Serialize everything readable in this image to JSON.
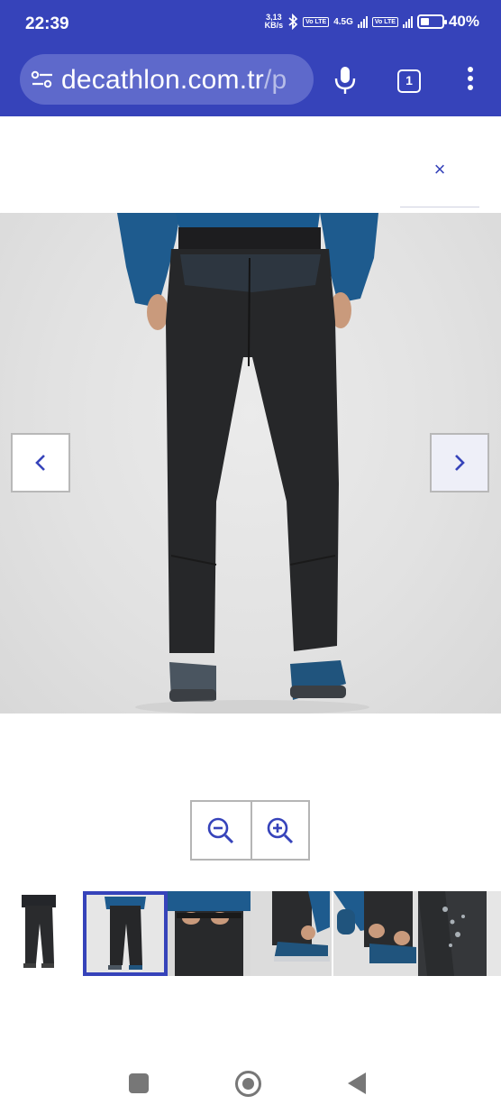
{
  "status_bar": {
    "time": "22:39",
    "net_speed_value": "3,13",
    "net_speed_unit": "KB/s",
    "sim1_label": "Vo LTE",
    "sim1_network": "4.5G",
    "sim2_label": "Vo LTE",
    "battery_percent_text": "40%",
    "battery_level": 0.4
  },
  "browser": {
    "url_main": "decathlon.com.tr",
    "url_rest": "/p",
    "tab_count": "1",
    "icons": [
      "site-settings-icon",
      "microphone-icon",
      "tab-switcher-icon",
      "more-menu-icon"
    ]
  },
  "modal": {
    "close_label": "×",
    "icons": [
      "close-icon",
      "chevron-left-icon",
      "chevron-right-icon",
      "zoom-out-icon",
      "zoom-in-icon"
    ]
  },
  "gallery": {
    "main_image": "Black hiking trousers, back view, worn with blue base layer and blue hiking boots",
    "selected_index": 1,
    "thumbnails": [
      "Full body front view of black trousers",
      "Back view of black trousers",
      "Waist detail with belt being fastened",
      "Ankle zip detail with blue boot",
      "Hands adjusting ankle closure",
      "Fabric close-up with water droplets"
    ]
  },
  "colors": {
    "brand": "#3643ba",
    "url_pill": "#5e69cb",
    "border_gray": "#b5b5b5"
  },
  "system_nav": {
    "icons": [
      "recents-square-icon",
      "home-circle-icon",
      "back-triangle-icon"
    ]
  }
}
